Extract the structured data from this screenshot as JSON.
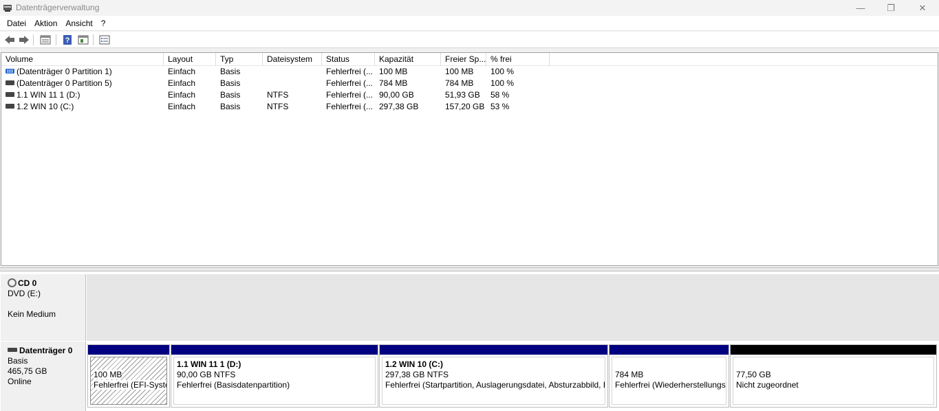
{
  "window": {
    "title": "Datenträgerverwaltung"
  },
  "menu": [
    "Datei",
    "Aktion",
    "Ansicht",
    "?"
  ],
  "toolbar": {
    "icons": [
      "back-arrow-icon",
      "forward-arrow-icon",
      "disk-list-icon",
      "help-icon",
      "properties-icon",
      "checklist-icon"
    ]
  },
  "volumes": {
    "columns": [
      "Volume",
      "Layout",
      "Typ",
      "Dateisystem",
      "Status",
      "Kapazität",
      "Freier Sp...",
      "% frei"
    ],
    "rows": [
      {
        "volume": "(Datenträger 0 Partition 1)",
        "layout": "Einfach",
        "typ": "Basis",
        "fs": "",
        "status": "Fehlerfrei (...",
        "kapazitaet": "100 MB",
        "frei": "100 MB",
        "prozent": "100 %",
        "icon": "blue-volume-icon"
      },
      {
        "volume": "(Datenträger 0 Partition 5)",
        "layout": "Einfach",
        "typ": "Basis",
        "fs": "",
        "status": "Fehlerfrei (...",
        "kapazitaet": "784 MB",
        "frei": "784 MB",
        "prozent": "100 %",
        "icon": "volume-icon"
      },
      {
        "volume": "1.1 WIN 11 1 (D:)",
        "layout": "Einfach",
        "typ": "Basis",
        "fs": "NTFS",
        "status": "Fehlerfrei (...",
        "kapazitaet": "90,00 GB",
        "frei": "51,93 GB",
        "prozent": "58 %",
        "icon": "volume-icon"
      },
      {
        "volume": "1.2 WIN 10 (C:)",
        "layout": "Einfach",
        "typ": "Basis",
        "fs": "NTFS",
        "status": "Fehlerfrei (...",
        "kapazitaet": "297,38 GB",
        "frei": "157,20 GB",
        "prozent": "53 %",
        "icon": "volume-icon"
      }
    ]
  },
  "cd": {
    "name": "CD 0",
    "drive": "DVD (E:)",
    "state": "Kein Medium"
  },
  "disk0": {
    "name": "Datenträger 0",
    "type": "Basis",
    "size": "465,75 GB",
    "state": "Online",
    "partitions": [
      {
        "title": "",
        "size": "100 MB",
        "status": "Fehlerfrei (EFI-Systempartition)"
      },
      {
        "title": "1.1 WIN 11 1  (D:)",
        "size": "90,00 GB NTFS",
        "status": "Fehlerfrei (Basisdatenpartition)"
      },
      {
        "title": "1.2 WIN 10  (C:)",
        "size": "297,38 GB NTFS",
        "status": "Fehlerfrei (Startpartition, Auslagerungsdatei, Absturzabbild, Basisdatenpartition)"
      },
      {
        "title": "",
        "size": "784 MB",
        "status": "Fehlerfrei (Wiederherstellungspartition)"
      },
      {
        "title": "",
        "size": "77,50 GB",
        "status": "Nicht zugeordnet"
      }
    ]
  }
}
